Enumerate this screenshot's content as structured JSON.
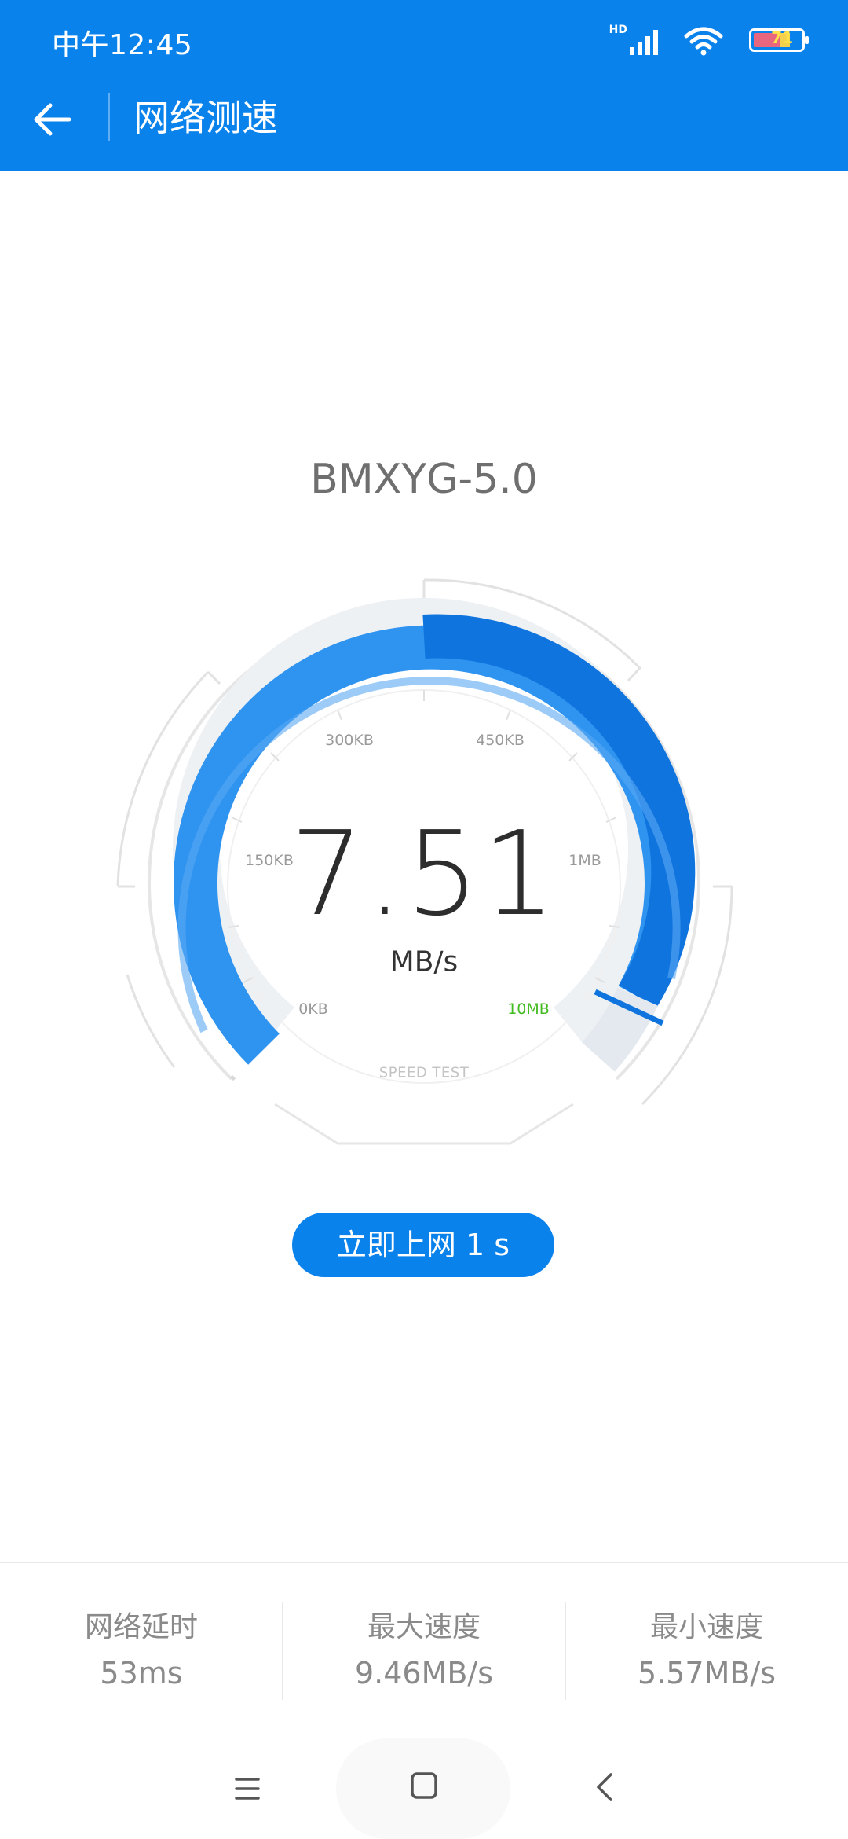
{
  "status_bar": {
    "time": "中午12:45",
    "hd": "HD",
    "battery_level": "71",
    "icons": [
      "signal-icon",
      "wifi-icon",
      "battery-icon"
    ]
  },
  "header": {
    "title": "网络测速",
    "back_icon": "back-arrow-icon"
  },
  "network_name": "BMXYG-5.0",
  "gauge": {
    "scale_labels": [
      "0KB",
      "150KB",
      "300KB",
      "450KB",
      "1MB",
      "10MB"
    ],
    "speed_value": "7.51",
    "unit": "MB/s",
    "caption": "SPEED TEST",
    "accent_color": "#0a82eb",
    "max_label_color": "#44bb22"
  },
  "action_button": {
    "label": "立即上网 1 s"
  },
  "stats": [
    {
      "label": "网络延时",
      "value": "53ms"
    },
    {
      "label": "最大速度",
      "value": "9.46MB/s"
    },
    {
      "label": "最小速度",
      "value": "5.57MB/s"
    }
  ],
  "nav_bar": {
    "icons": [
      "menu-icon",
      "home-icon",
      "back-icon"
    ]
  }
}
